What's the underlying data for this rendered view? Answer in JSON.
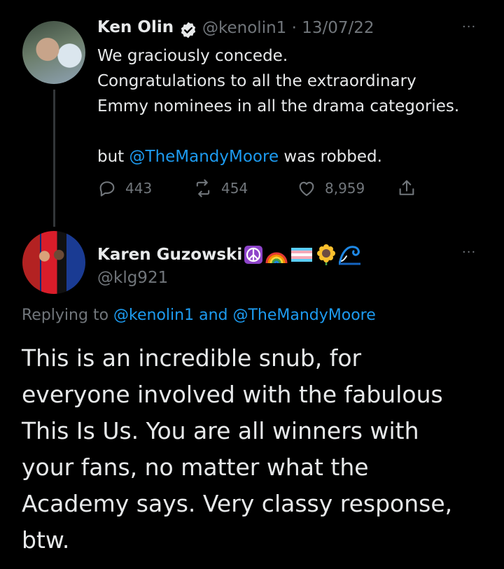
{
  "tweet1": {
    "name": "Ken Olin",
    "handle": "@kenolin1",
    "date": "13/07/22",
    "lines": [
      "We graciously concede.",
      "Congratulations to all the extraordinary",
      "Emmy nominees in all the drama categories."
    ],
    "mention_prefix": "but ",
    "mention": "@TheMandyMoore",
    "mention_suffix": " was robbed.",
    "replies": "443",
    "retweets": "454",
    "likes": "8,959",
    "more": "···"
  },
  "tweet2": {
    "name": "Karen Guzowski",
    "emoji_names": [
      "peace-icon",
      "rainbow-icon",
      "trans-flag-icon",
      "sunflower-icon",
      "wave-icon"
    ],
    "handle": "@klg921",
    "more": "···",
    "replying_prefix": "Replying to ",
    "replying_mentions": "@kenolin1 and @TheMandyMoore",
    "text_lines": [
      "This is an incredible snub, for",
      "everyone involved with the fabulous",
      "This Is Us. You are all winners with",
      "your fans, no matter what the",
      "Academy says. Very classy response,",
      "btw."
    ]
  },
  "colors": {
    "background": "#000000",
    "text": "#e7e9ea",
    "muted": "#71767b",
    "link": "#1d9bf0"
  }
}
